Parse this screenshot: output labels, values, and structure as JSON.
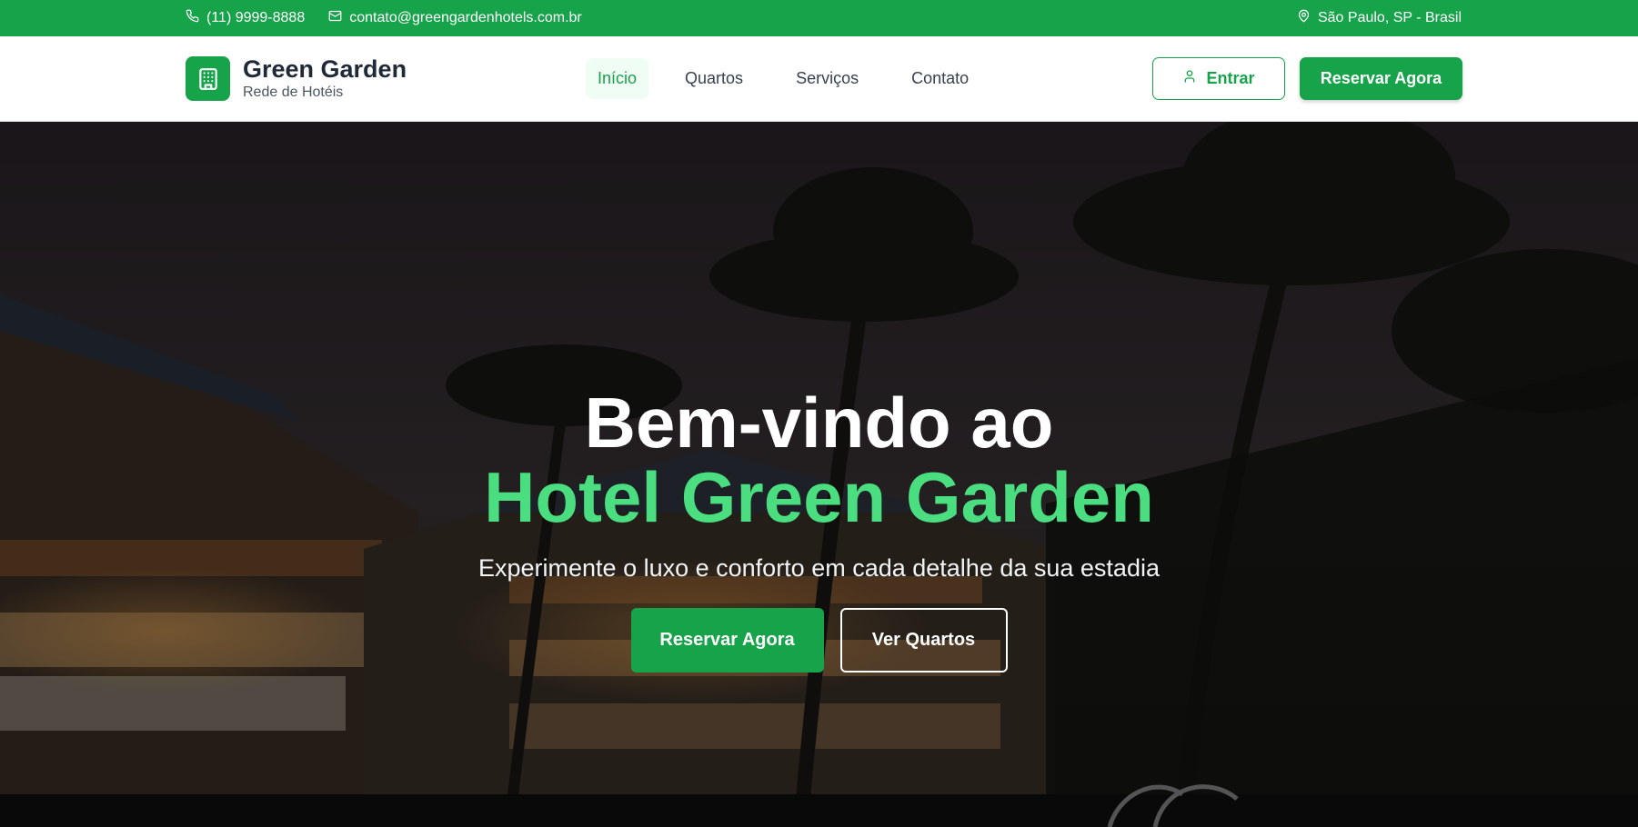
{
  "topbar": {
    "phone": "(11) 9999-8888",
    "email": "contato@greengardenhotels.com.br",
    "location": "São Paulo, SP - Brasil"
  },
  "brand": {
    "name": "Green Garden",
    "tagline": "Rede de Hotéis",
    "logo_icon": "building-icon"
  },
  "nav": {
    "items": [
      {
        "label": "Início",
        "active": true
      },
      {
        "label": "Quartos",
        "active": false
      },
      {
        "label": "Serviços",
        "active": false
      },
      {
        "label": "Contato",
        "active": false
      }
    ]
  },
  "header_actions": {
    "login_label": "Entrar",
    "login_icon": "user-icon",
    "book_label": "Reservar Agora"
  },
  "hero": {
    "title_line1": "Bem-vindo ao",
    "title_line2": "Hotel Green Garden",
    "subtitle": "Experimente o luxo e conforto em cada detalhe da sua estadia",
    "primary_button": "Reservar Agora",
    "secondary_button": "Ver Quartos"
  },
  "colors": {
    "brand_green": "#16a34a",
    "accent_green": "#4ade80",
    "nav_active_bg": "#f0fdf4"
  }
}
